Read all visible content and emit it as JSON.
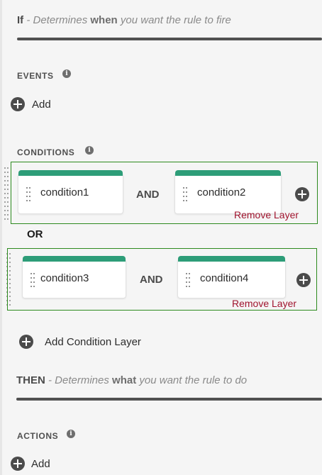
{
  "if_heading": {
    "keyword": "If",
    "prefix": " - Determines ",
    "strong": "when",
    "suffix": " you want the rule to fire"
  },
  "events": {
    "label": "EVENTS",
    "add_label": "Add"
  },
  "conditions": {
    "label": "CONDITIONS",
    "layers": [
      {
        "left": "condition1",
        "operator": "AND",
        "right": "condition2",
        "remove_label": "Remove Layer"
      },
      {
        "left": "condition3",
        "operator": "AND",
        "right": "condition4",
        "remove_label": "Remove Layer"
      }
    ],
    "layer_join": "OR",
    "add_layer_label": "Add Condition Layer"
  },
  "then_heading": {
    "keyword": "THEN",
    "prefix": " - Determines ",
    "strong": "what",
    "suffix": " you want the rule to do"
  },
  "actions": {
    "label": "ACTIONS",
    "add_label": "Add"
  },
  "colors": {
    "layer_border": "#2d8a1e",
    "card_topbar": "#2d9d78",
    "remove_text": "#a0142e"
  }
}
